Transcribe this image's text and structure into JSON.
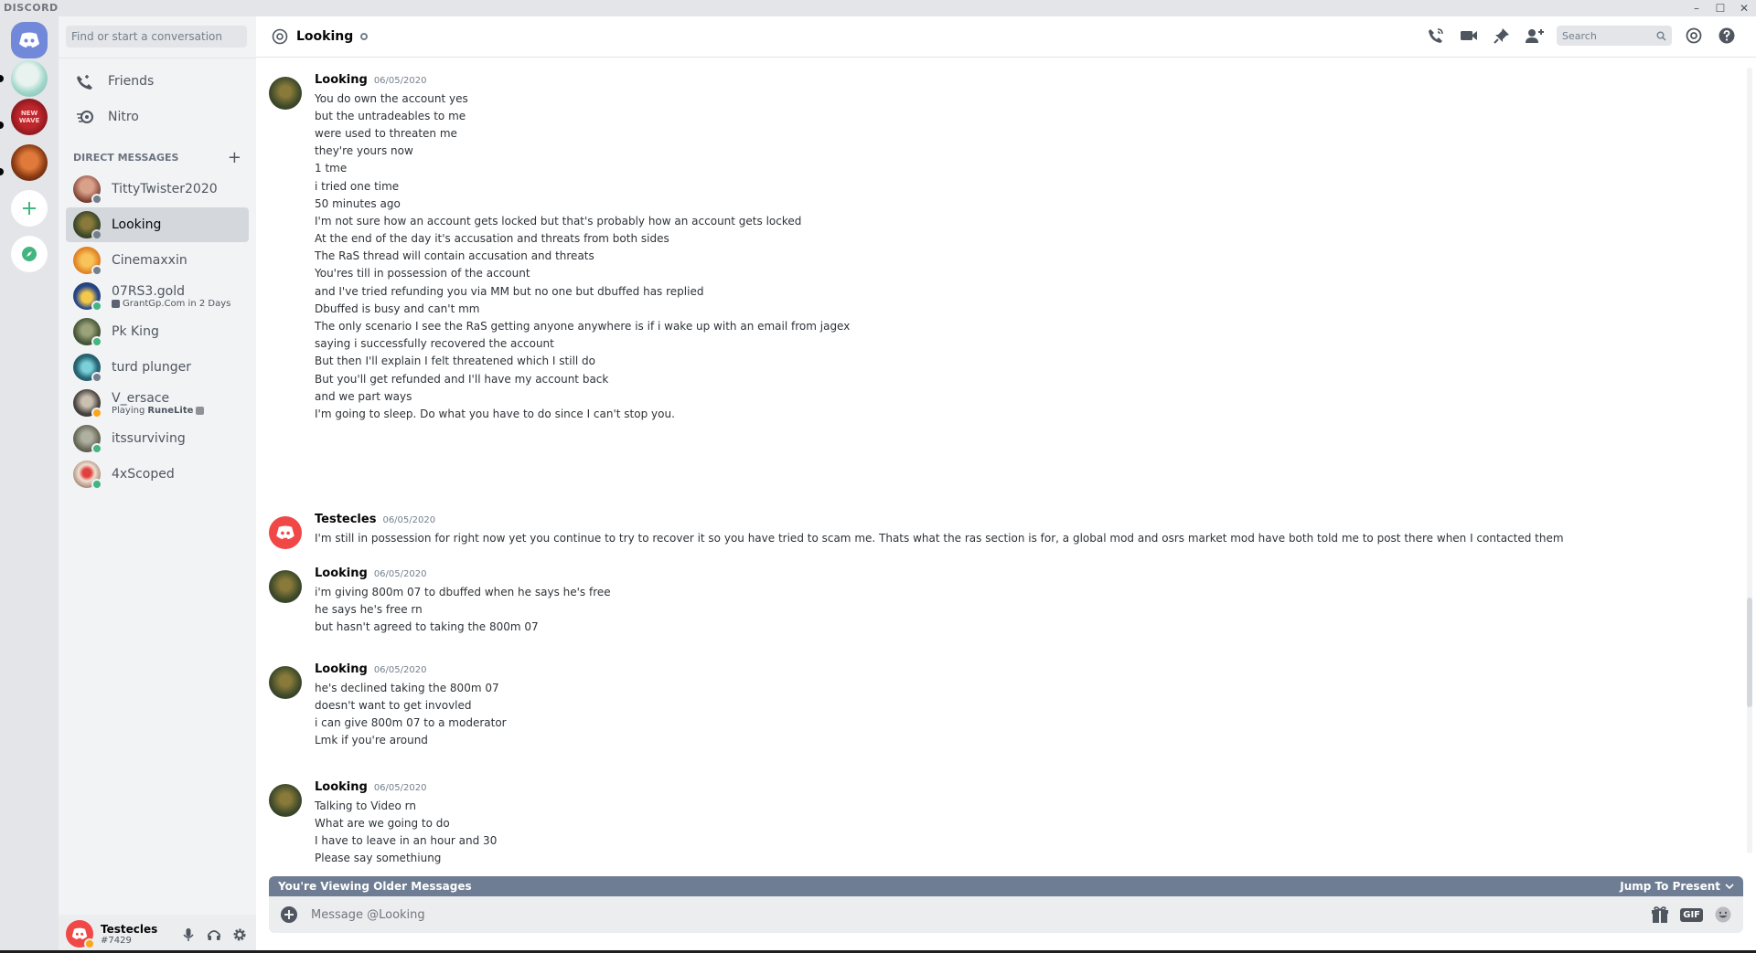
{
  "titlebar": {
    "brand": "DISCORD",
    "minimize": "–",
    "maximize": "☐",
    "close": "✕"
  },
  "sidebar": {
    "search_placeholder": "Find or start a conversation",
    "nav": [
      {
        "label": "Friends"
      },
      {
        "label": "Nitro"
      }
    ],
    "dm_header": "DIRECT MESSAGES",
    "dm_add": "+",
    "dms": [
      {
        "name": "TittyTwister2020",
        "status": "offline",
        "sub": ""
      },
      {
        "name": "Looking",
        "status": "offline",
        "sub": ""
      },
      {
        "name": "Cinemaxxin",
        "status": "offline",
        "sub": ""
      },
      {
        "name": "07RS3.gold",
        "status": "online",
        "sub": "GrantGp.Com in 2 Days"
      },
      {
        "name": "Pk King",
        "status": "online",
        "sub": ""
      },
      {
        "name": "turd plunger",
        "status": "offline",
        "sub": ""
      },
      {
        "name": "V_ersace",
        "status": "idle",
        "sub_prefix": "Playing",
        "sub_game": "RuneLite"
      },
      {
        "name": "itssurviving",
        "status": "online",
        "sub": ""
      },
      {
        "name": "4xScoped",
        "status": "online",
        "sub": ""
      }
    ]
  },
  "user": {
    "name": "Testecles",
    "tag": "#7429"
  },
  "header": {
    "title": "Looking",
    "search_placeholder": "Search"
  },
  "messages": [
    {
      "author": "Looking",
      "date": "06/05/2020",
      "lines": [
        "You do own the account yes",
        "but the untradeables to me",
        "were used to threaten me",
        "they're yours now",
        "1 tme",
        "i tried one time",
        "50 minutes ago",
        "I'm not sure how an account gets locked but that's probably how an account gets locked",
        "At the end of the day it's accusation and threats from both sides",
        "The RaS thread will contain accusation and threats",
        "You'res till in possession of the account",
        "and I've tried refunding you via MM but no one but dbuffed has replied",
        "Dbuffed is busy and can't mm",
        "The only scenario I see the RaS getting anyone anywhere is if i wake up with an email from jagex",
        "saying i successfully recovered the account",
        "But then I'll explain I felt threatened which I still do",
        "But you'll get refunded and I'll have my account back",
        "and we part ways",
        "I'm going to sleep. Do what you have to do since I can't stop you."
      ]
    },
    {
      "author": "Testecles",
      "date": "06/05/2020",
      "lines": [
        "I'm still in possession for right now yet you continue to try to recover it so you have tried to scam me. Thats what the ras section is for, a global mod and osrs market mod have both told me to post there when I contacted them"
      ]
    },
    {
      "author": "Looking",
      "date": "06/05/2020",
      "lines": [
        "i'm giving 800m 07 to dbuffed when he says he's free",
        "he says he's free rn",
        "but hasn't agreed to taking the 800m 07"
      ]
    },
    {
      "author": "Looking",
      "date": "06/05/2020",
      "lines": [
        "he's declined taking the 800m 07",
        "doesn't want to get invovled",
        "i can give 800m 07 to a moderator",
        "Lmk if you're around"
      ]
    },
    {
      "author": "Looking",
      "date": "06/05/2020",
      "lines": [
        "Talking to Video rn",
        "What are we going to do",
        "I have to leave in an hour and 30",
        "Please say somethiung"
      ]
    }
  ],
  "older_bar": {
    "label": "You're Viewing Older Messages",
    "jump": "Jump To Present"
  },
  "composer": {
    "placeholder": "Message @Looking",
    "gif": "GIF"
  },
  "colors": {
    "blurple": "#7289da",
    "online": "#43b581",
    "idle": "#faa61a",
    "offline": "#747f8d"
  }
}
